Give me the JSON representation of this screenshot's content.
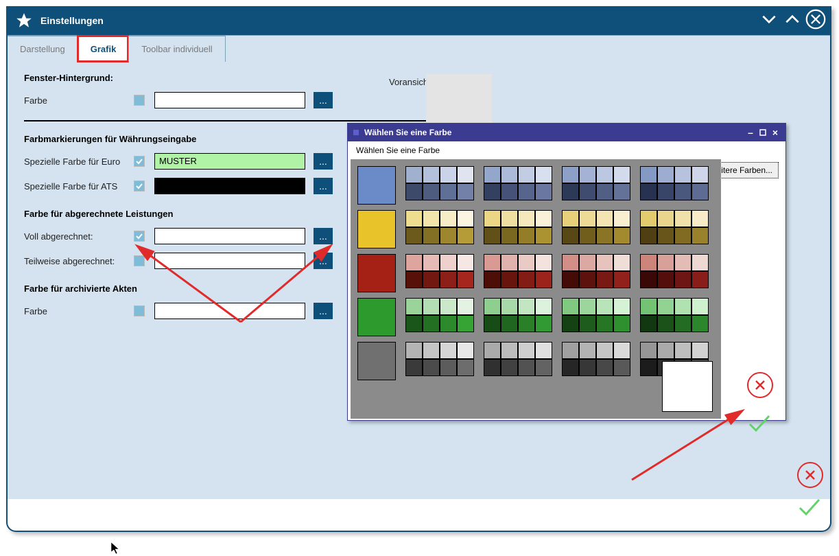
{
  "window": {
    "title": "Einstellungen"
  },
  "tabs": {
    "t1": "Darstellung",
    "t2": "Grafik",
    "t3": "Toolbar individuell"
  },
  "sec1": {
    "title": "Fenster-Hintergrund:",
    "farbe": "Farbe",
    "preview": "Voransicht"
  },
  "sec2": {
    "title": "Farbmarkierungen für Währungseingabe",
    "euro": "Spezielle Farbe für Euro",
    "ats": "Spezielle Farbe für ATS",
    "muster": "MUSTER"
  },
  "sec3": {
    "title": "Farbe für abgerechnete Leistungen",
    "voll": "Voll abgerechnet:",
    "teil": "Teilweise abgerechnet:"
  },
  "sec4": {
    "title": "Farbe für archivierte Akten",
    "farbe": "Farbe"
  },
  "dots": "...",
  "colordlg": {
    "title": "Wählen Sie eine Farbe",
    "label": "Wählen Sie eine Farbe",
    "more": "weitere Farben..."
  },
  "palette": {
    "blue": {
      "main": "#6a8bc8",
      "g": [
        [
          "#a0b1d0",
          "#b4c1dd",
          "#cad3e7",
          "#dfe4f0",
          "#3d4a6a",
          "#4e5c80",
          "#606f95",
          "#7380a8"
        ],
        [
          "#93a6cc",
          "#abbad9",
          "#c2cde4",
          "#d8dfee",
          "#33405f",
          "#465278",
          "#57648c",
          "#6a77a0"
        ],
        [
          "#8ca0c8",
          "#a4b3d5",
          "#bcc7e1",
          "#d3daeb",
          "#2c3957",
          "#3f4c70",
          "#515f85",
          "#647199"
        ],
        [
          "#8499c4",
          "#9dadd1",
          "#b6c2de",
          "#cfd6e9",
          "#26324f",
          "#384568",
          "#4b587e",
          "#5e6b93"
        ]
      ]
    },
    "yellow": {
      "main": "#e9c32a",
      "g": [
        [
          "#eedc8f",
          "#f2e4aa",
          "#f6ecc5",
          "#faf4e0",
          "#6b5a1b",
          "#847024",
          "#9d862d",
          "#b69c36"
        ],
        [
          "#ead684",
          "#efdfa0",
          "#f4e8bc",
          "#f9f1d8",
          "#615118",
          "#7a6720",
          "#937d29",
          "#ac9332"
        ],
        [
          "#e6d079",
          "#ecda96",
          "#f2e4b3",
          "#f8eed0",
          "#584815",
          "#715e1d",
          "#8a7426",
          "#a38a2f"
        ],
        [
          "#e2ca6e",
          "#e9d58c",
          "#f0e0aa",
          "#f7ebc8",
          "#4f3f12",
          "#68551a",
          "#816b23",
          "#9a812c"
        ]
      ]
    },
    "red": {
      "main": "#a52115",
      "g": [
        [
          "#dea59f",
          "#e6bbb6",
          "#eed1cd",
          "#f6e7e4",
          "#581109",
          "#721810",
          "#8c1f17",
          "#a6261e"
        ],
        [
          "#d89a93",
          "#e1b2ac",
          "#eacac5",
          "#f3e2de",
          "#4e0e08",
          "#68150e",
          "#821c15",
          "#9c231c"
        ],
        [
          "#d28f87",
          "#dca9a2",
          "#e6c3bd",
          "#f0ddd8",
          "#440b07",
          "#5e120d",
          "#781914",
          "#92201b"
        ],
        [
          "#cc847b",
          "#d7a098",
          "#e2bcb5",
          "#edd8d2",
          "#3a0806",
          "#540f0c",
          "#6e1613",
          "#881d1a"
        ]
      ]
    },
    "green": {
      "main": "#2d9a2d",
      "g": [
        [
          "#9bd49b",
          "#b3deb3",
          "#cbe8cb",
          "#e3f2e3",
          "#1a561a",
          "#237023",
          "#2c8a2c",
          "#35a435"
        ],
        [
          "#8ece8e",
          "#a8daa8",
          "#c2e6c2",
          "#dcf2dc",
          "#174c17",
          "#206620",
          "#298029",
          "#329a32"
        ],
        [
          "#81c881",
          "#9dd69d",
          "#b9e4b9",
          "#d5f2d5",
          "#144214",
          "#1d5c1d",
          "#267626",
          "#2f902f"
        ],
        [
          "#74c274",
          "#92d292",
          "#b0e2b0",
          "#cef2ce",
          "#113811",
          "#1a521a",
          "#236c23",
          "#2c862c"
        ]
      ]
    },
    "grey": {
      "main": "#707070",
      "g": [
        [
          "#b4b4b4",
          "#c5c5c5",
          "#d6d6d6",
          "#e7e7e7",
          "#3a3a3a",
          "#4b4b4b",
          "#5c5c5c",
          "#6d6d6d"
        ],
        [
          "#aaaaaa",
          "#bcbcbc",
          "#cecece",
          "#e0e0e0",
          "#303030",
          "#414141",
          "#525252",
          "#636363"
        ],
        [
          "#a0a0a0",
          "#b3b3b3",
          "#c6c6c6",
          "#d9d9d9",
          "#262626",
          "#373737",
          "#484848",
          "#595959"
        ],
        [
          "#969696",
          "#aaaaaa",
          "#bebebe",
          "#d2d2d2",
          "#1c1c1c",
          "#2d2d2d",
          "#3e3e3e",
          "#4f4f4f"
        ]
      ]
    }
  }
}
